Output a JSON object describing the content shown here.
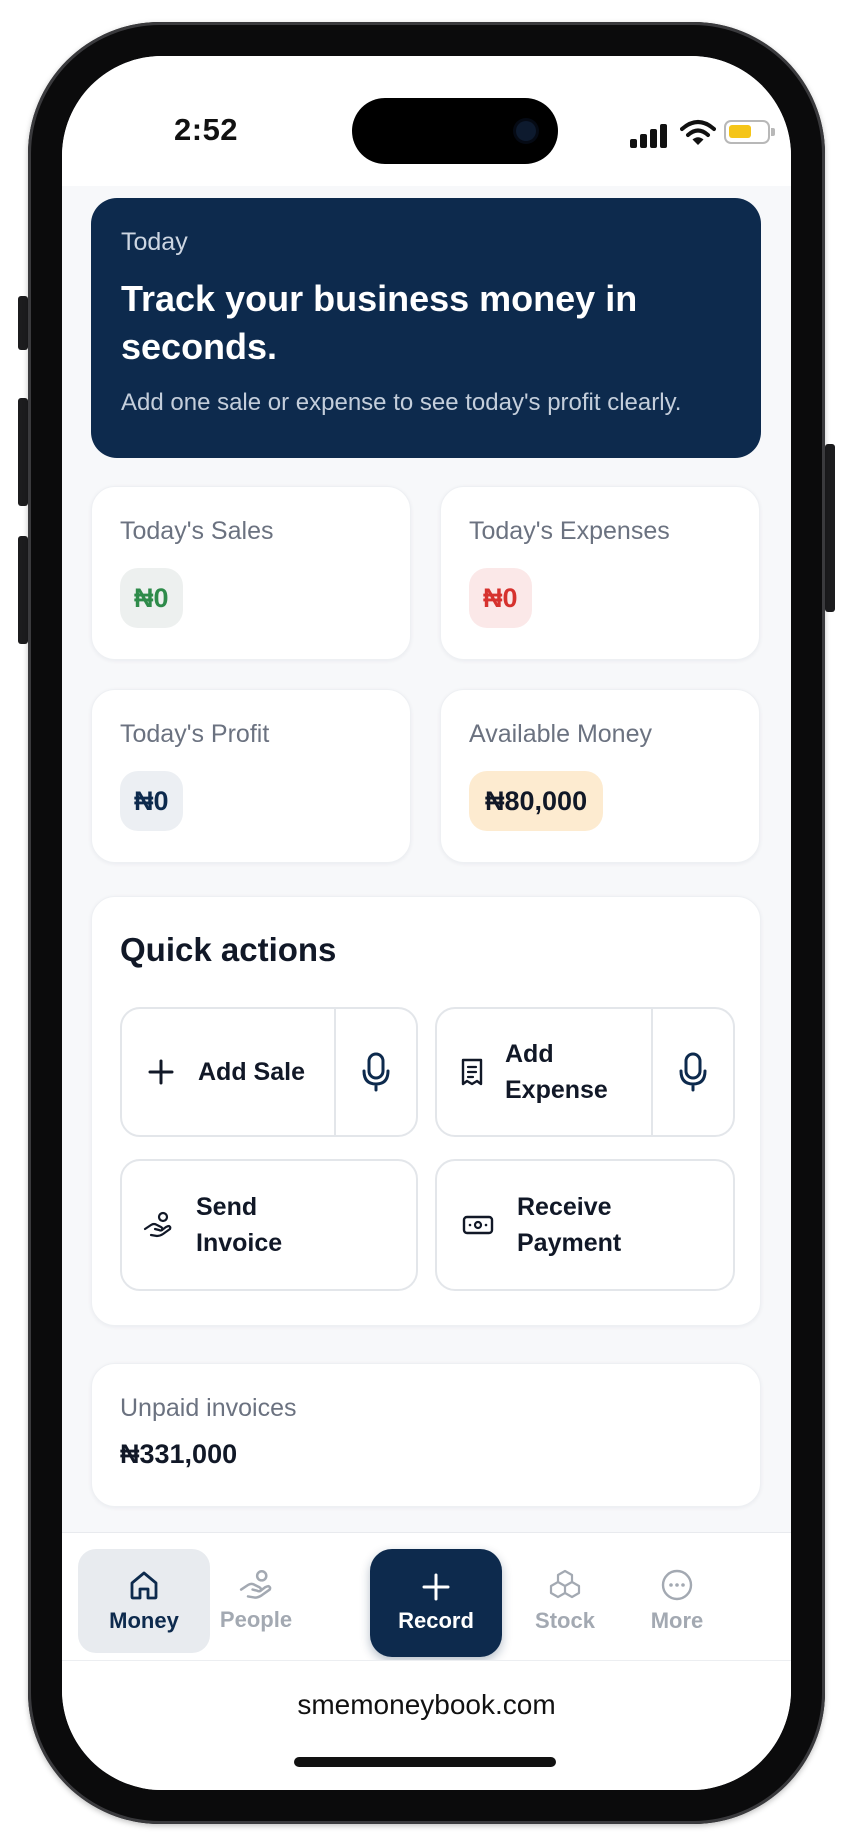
{
  "status_bar": {
    "time": "2:52"
  },
  "hero": {
    "kicker": "Today",
    "title": "Track your business money in seconds.",
    "subtitle": "Add one sale or expense to see today's profit clearly."
  },
  "stats": {
    "sales": {
      "label": "Today's Sales",
      "value": "₦0"
    },
    "expenses": {
      "label": "Today's Expenses",
      "value": "₦0"
    },
    "profit": {
      "label": "Today's Profit",
      "value": "₦0"
    },
    "available": {
      "label": "Available Money",
      "value": "₦80,000"
    }
  },
  "quick_actions": {
    "title": "Quick actions",
    "add_sale": "Add Sale",
    "add_expense": "Add Expense",
    "send_invoice": "Send Invoice",
    "receive_payment": "Receive Payment"
  },
  "unpaid": {
    "label": "Unpaid invoices",
    "value": "₦331,000"
  },
  "nav": {
    "money": "Money",
    "people": "People",
    "record": "Record",
    "stock": "Stock",
    "more": "More"
  },
  "browser": {
    "url": "smemoneybook.com"
  },
  "colors": {
    "navy": "#0d2a4d",
    "sales_green": "#2e8b4a",
    "expense_red": "#d6322e",
    "available_amber_bg": "#fdebd0",
    "battery_yellow": "#f5c518"
  }
}
